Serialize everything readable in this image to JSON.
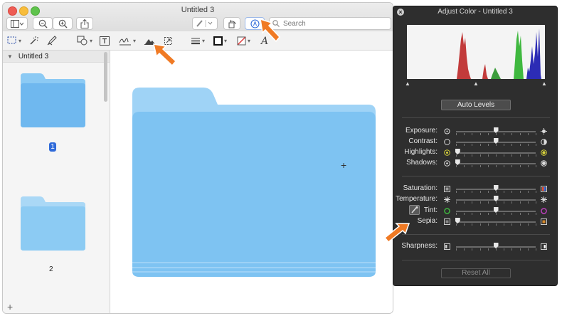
{
  "window": {
    "title": "Untitled 3"
  },
  "toolbar": {
    "search_placeholder": "Search"
  },
  "sidebar": {
    "section_title": "Untitled 3",
    "pages": [
      {
        "number": "1",
        "selected": true
      },
      {
        "number": "2",
        "selected": false
      }
    ],
    "add_label": "+"
  },
  "adjust_color": {
    "title": "Adjust Color - Untitled 3",
    "auto_levels_label": "Auto Levels",
    "reset_all_label": "Reset All",
    "sliders": [
      {
        "label": "Exposure:",
        "value": 0.5
      },
      {
        "label": "Contrast:",
        "value": 0.5
      },
      {
        "label": "Highlights:",
        "value": 0.02
      },
      {
        "label": "Shadows:",
        "value": 0.02
      },
      {
        "label": "Saturation:",
        "value": 0.5
      },
      {
        "label": "Temperature:",
        "value": 0.5
      },
      {
        "label": "Tint:",
        "value": 0.5
      },
      {
        "label": "Sepia:",
        "value": 0.02
      },
      {
        "label": "Sharpness:",
        "value": 0.5
      }
    ]
  },
  "colors": {
    "accent": "#2f6ad9",
    "arrow": "#f07a24",
    "folder": "#7ec3f2"
  }
}
